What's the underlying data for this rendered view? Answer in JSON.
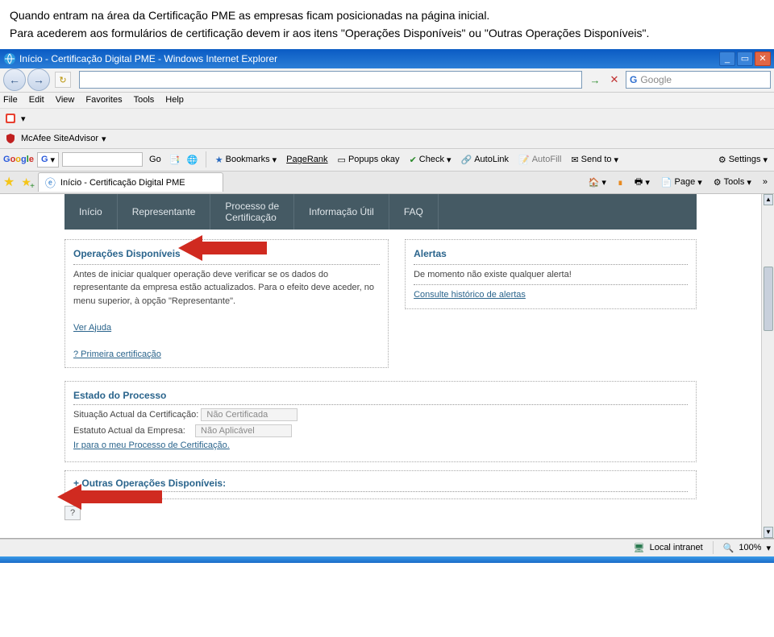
{
  "doc": {
    "p1": "Quando entram na área da Certificação PME as empresas ficam posicionadas na página inicial.",
    "p2": "Para acederem aos formulários de certificação devem ir aos itens \"Operações Disponíveis\" ou \"Outras Operações Disponíveis\"."
  },
  "window": {
    "title": "Início - Certificação Digital PME - Windows Internet Explorer",
    "min": "_",
    "max": "▭",
    "close": "✕"
  },
  "nav": {
    "back": "←",
    "fwd": "→",
    "refresh": "↻",
    "search_placeholder": "Google",
    "go": "→",
    "stop": "✕"
  },
  "menu": {
    "file": "File",
    "edit": "Edit",
    "view": "View",
    "favorites": "Favorites",
    "tools": "Tools",
    "help": "Help"
  },
  "mcafee": {
    "label": "McAfee SiteAdvisor",
    "caret": "▾"
  },
  "google_tb": {
    "brand": "Google",
    "g": "G",
    "go": "Go",
    "bookmarks": "Bookmarks",
    "pagerank": "PageRank",
    "popups": "Popups okay",
    "check": "Check",
    "autolink": "AutoLink",
    "autofill": "AutoFill",
    "sendto": "Send to",
    "settings": "Settings",
    "caret": "▾"
  },
  "tab": {
    "title": "Início - Certificação Digital PME",
    "star": "★",
    "plus": "+"
  },
  "tabtools": {
    "home": "▾",
    "print": "▾",
    "page": "Page",
    "tools": "Tools",
    "more": "»",
    "caret": "▾"
  },
  "sitenav": {
    "inicio": "Início",
    "representante": "Representante",
    "processo_l1": "Processo de",
    "processo_l2": "Certificação",
    "info": "Informação Útil",
    "faq": "FAQ"
  },
  "operacoes": {
    "title": "Operações Disponíveis",
    "body1": "Antes de iniciar qualquer operação deve verificar se os dados do representante da empresa estão actualizados. Para o efeito deve aceder, no menu superior, à opção \"Representante\".",
    "ver_ajuda": "Ver Ajuda",
    "primeira": "?  Primeira certificação"
  },
  "alertas": {
    "title": "Alertas",
    "msg": "De momento não existe qualquer alerta!",
    "link": "Consulte histórico de alertas"
  },
  "estado": {
    "title": "Estado do Processo",
    "sit_label": "Situação Actual da Certificação:",
    "sit_value": "Não Certificada",
    "est_label": "Estatuto Actual da Empresa:",
    "est_value": "Não Aplicável",
    "link": "Ir para o meu Processo de Certificação."
  },
  "outras": {
    "plus": "+",
    "label": "Outras Operações Disponíveis:"
  },
  "help": {
    "q": "?"
  },
  "status": {
    "zone": "Local intranet",
    "zoom": "100%",
    "mag": "🔍",
    "caret": "▾"
  }
}
